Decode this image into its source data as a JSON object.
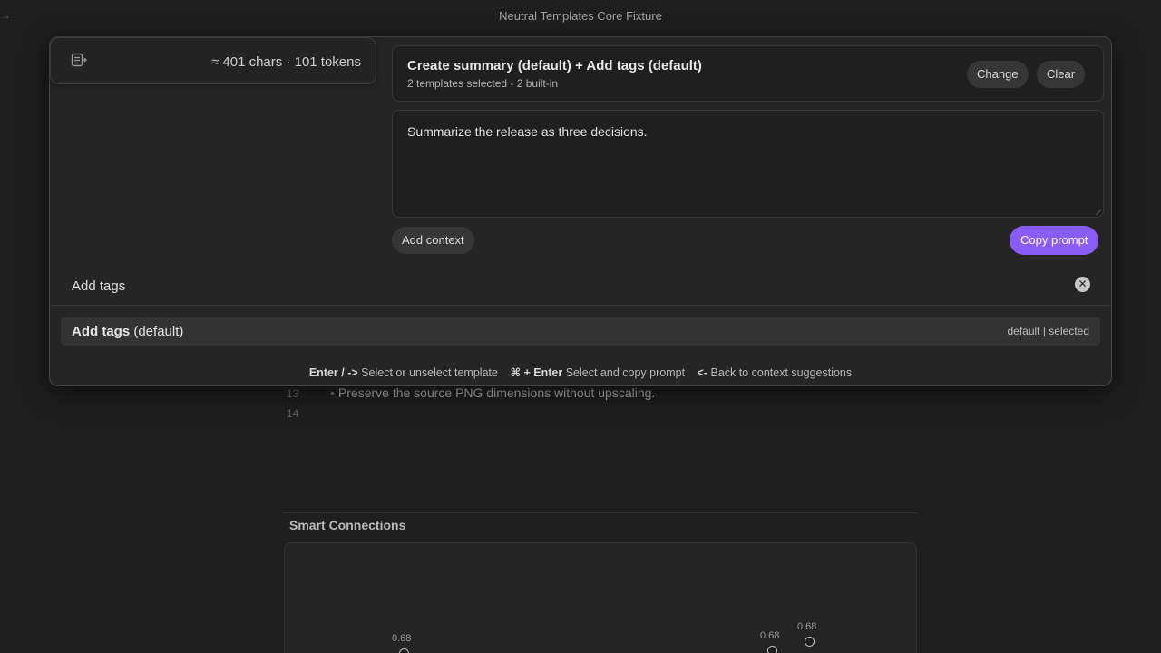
{
  "window": {
    "title": "Neutral Templates Core Fixture",
    "back_icon": "arrow-right-icon"
  },
  "note": {
    "lines": [
      {
        "number": "13",
        "text": "Preserve the source PNG dimensions without upscaling."
      },
      {
        "number": "14",
        "text": ""
      }
    ]
  },
  "smart_connections": {
    "title": "Smart Connections",
    "nodes": [
      {
        "score": "0.68"
      },
      {
        "score": "0.68"
      },
      {
        "score": "0.68"
      }
    ]
  },
  "modal": {
    "stats": {
      "icon": "insert-text-icon",
      "text": "≈ 401 chars · 101 tokens"
    },
    "selection": {
      "title": "Create summary (default) + Add tags (default)",
      "subtitle": "2 templates selected - 2 built-in",
      "change_label": "Change",
      "clear_label": "Clear"
    },
    "prompt": {
      "value": "Summarize the release as three decisions."
    },
    "add_context_label": "Add context",
    "copy_prompt_label": "Copy prompt",
    "accent_color": "#8a5cf6",
    "search": {
      "value": "Add tags",
      "placeholder": ""
    },
    "results": [
      {
        "name": "Add tags",
        "suffix": "(default)",
        "meta": "default | selected"
      }
    ],
    "hints": [
      {
        "key": "Enter / ->",
        "desc": "Select or unselect template"
      },
      {
        "key": "⌘ + Enter",
        "desc": "Select and copy prompt"
      },
      {
        "key": "<-",
        "desc": "Back to context suggestions"
      }
    ]
  }
}
